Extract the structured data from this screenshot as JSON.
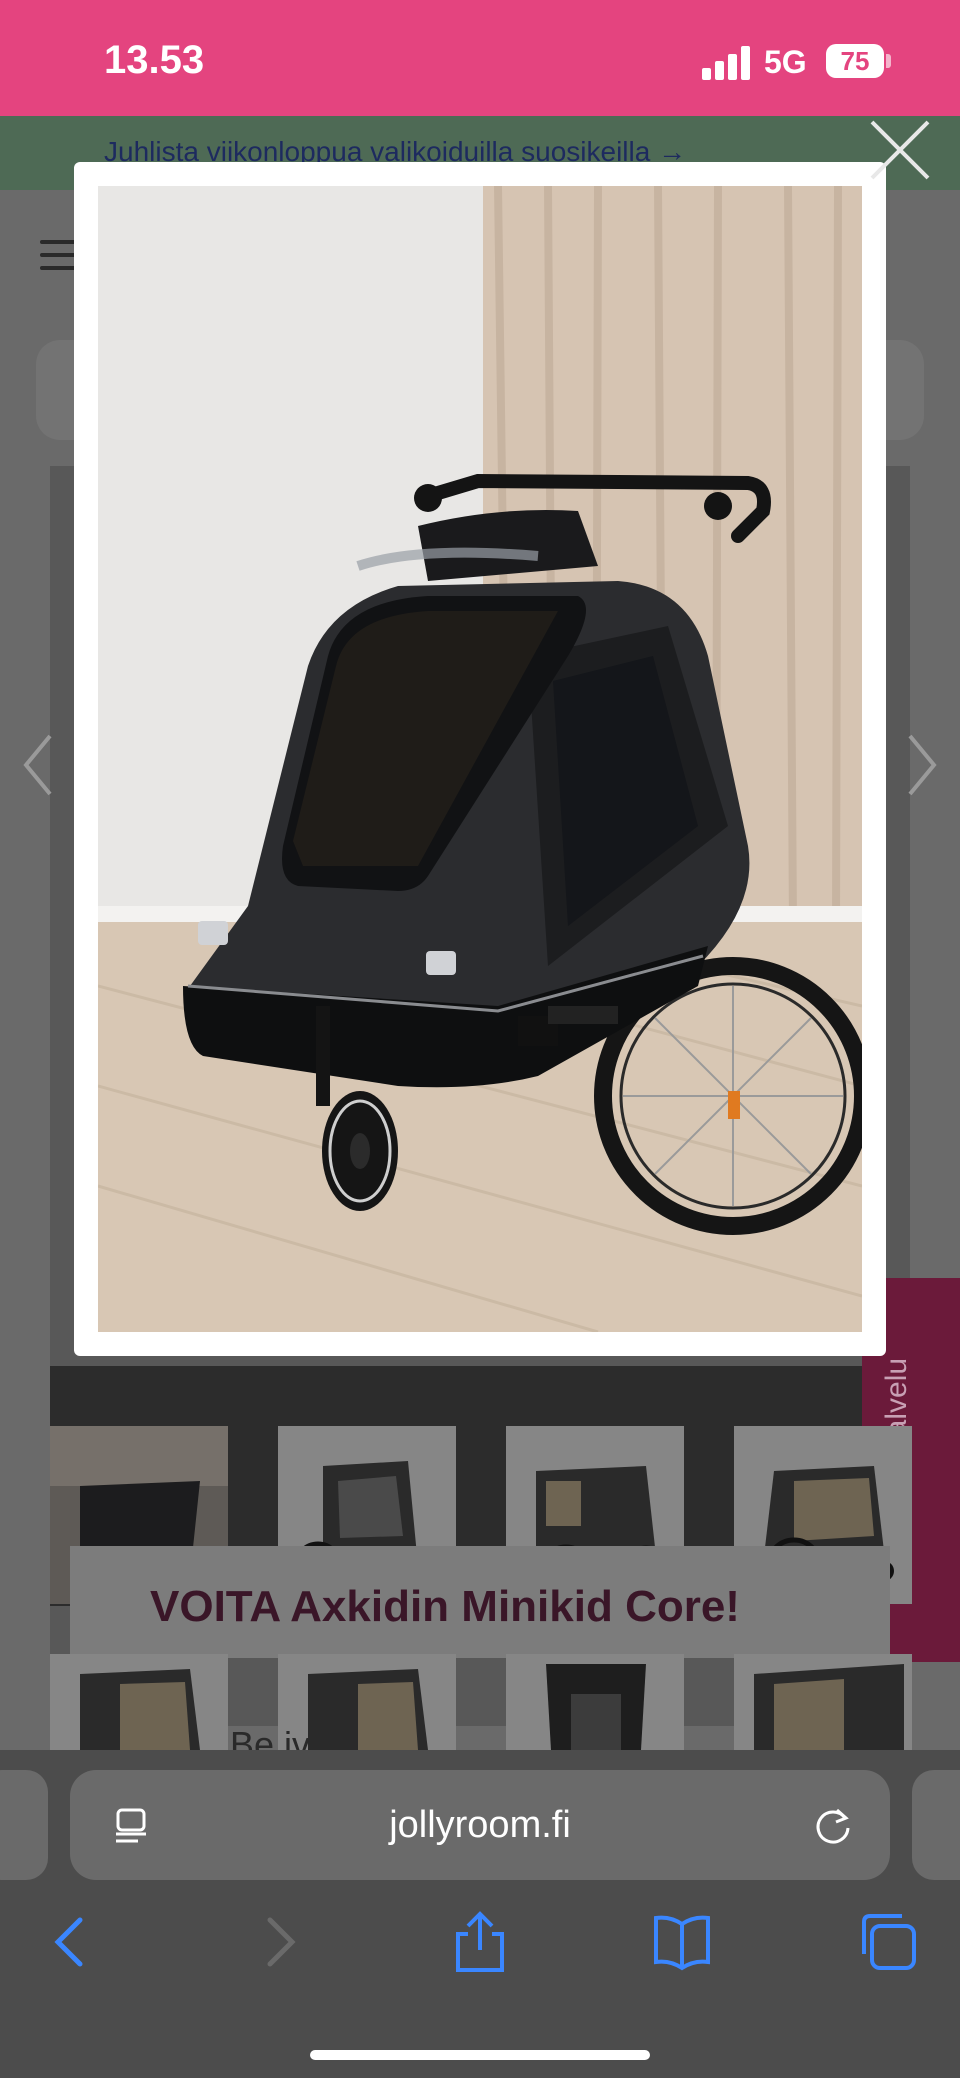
{
  "status_bar": {
    "time": "13.53",
    "network": "5G",
    "battery": "75"
  },
  "page": {
    "promo_text": "Juhlista viikonloppua valikoiduilla suosikeilla →",
    "banner_text": "VOITA Axkidin Minikid Core!",
    "partial_text": "Be           ivit",
    "customer_service_tab": "Asiakaspalvelu"
  },
  "modal": {
    "image_subject": "bike trailer stroller",
    "close_icon": "close-icon"
  },
  "browser": {
    "url": "jollyroom.fi"
  },
  "colors": {
    "status_bar": "#e4447f",
    "accent_blue": "#3a86ff"
  }
}
